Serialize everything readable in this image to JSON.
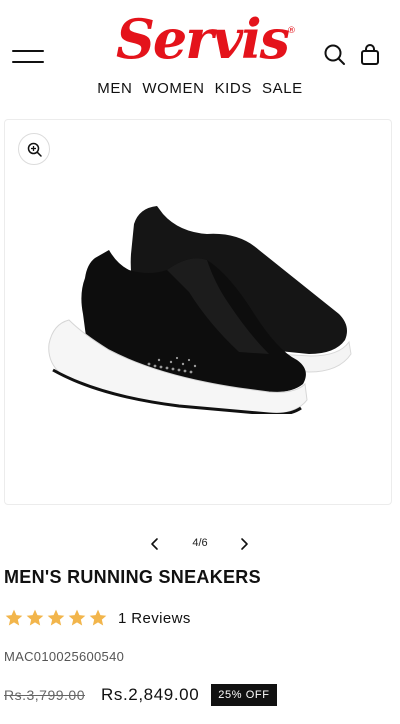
{
  "header": {
    "brand_name": "Servis",
    "brand_mark": "®",
    "nav": [
      "MEN",
      "WOMEN",
      "KIDS",
      "SALE"
    ],
    "icons": {
      "menu": "hamburger-icon",
      "search": "search-icon",
      "bag": "shopping-bag-icon"
    }
  },
  "gallery": {
    "zoom_icon": "zoom-in-icon",
    "current": "4/6",
    "prev_icon": "chevron-left-icon",
    "next_icon": "chevron-right-icon"
  },
  "product": {
    "title": "MEN'S RUNNING SNEAKERS",
    "rating": 5,
    "rating_max": 5,
    "reviews_label": "1 Reviews",
    "sku": "MAC010025600540",
    "old_price": "Rs.3,799.00",
    "new_price": "Rs.2,849.00",
    "discount": "25% OFF"
  },
  "colors": {
    "brand_red": "#e4131b",
    "star": "#f2b54b",
    "badge_bg": "#111111"
  }
}
